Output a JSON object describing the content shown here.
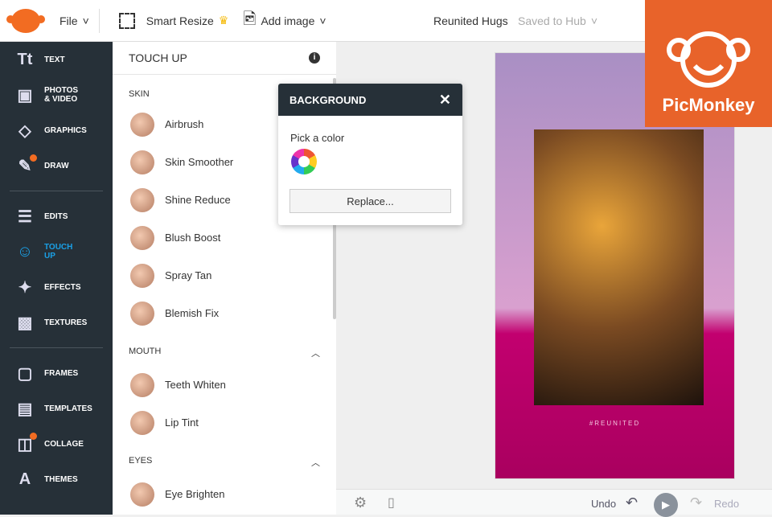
{
  "topbar": {
    "file": "File",
    "smart_resize": "Smart Resize",
    "add_image": "Add image",
    "doc_title": "Reunited Hugs",
    "save_status": "Saved to Hub"
  },
  "sidebar": [
    {
      "label": "TEXT",
      "icon": "Tt"
    },
    {
      "label": "PHOTOS & VIDEO",
      "icon": "▣"
    },
    {
      "label": "GRAPHICS",
      "icon": "◇"
    },
    {
      "label": "DRAW",
      "icon": "✎"
    },
    {
      "label": "EDITS",
      "icon": "☰"
    },
    {
      "label": "TOUCH UP",
      "icon": "☺"
    },
    {
      "label": "EFFECTS",
      "icon": "✦"
    },
    {
      "label": "TEXTURES",
      "icon": "▩"
    },
    {
      "label": "FRAMES",
      "icon": "▢"
    },
    {
      "label": "TEMPLATES",
      "icon": "▤"
    },
    {
      "label": "COLLAGE",
      "icon": "◫"
    },
    {
      "label": "THEMES",
      "icon": "A"
    }
  ],
  "panel": {
    "title": "TOUCH UP",
    "skin": "SKIN",
    "skin_items": [
      "Airbrush",
      "Skin Smoother",
      "Shine Reduce",
      "Blush Boost",
      "Spray Tan",
      "Blemish Fix"
    ],
    "mouth": "MOUTH",
    "mouth_items": [
      "Teeth Whiten",
      "Lip Tint"
    ],
    "eyes": "EYES",
    "eyes_items": [
      "Eye Brighten"
    ]
  },
  "popup": {
    "title": "BACKGROUND",
    "pick": "Pick a color",
    "replace": "Replace..."
  },
  "canvas": {
    "hashtag": "#REUNITED"
  },
  "bottom": {
    "undo": "Undo",
    "redo": "Redo"
  },
  "brand": {
    "name": "PicMonkey"
  },
  "colors": {
    "accent": "#f26c22",
    "sidebar": "#263038",
    "active": "#1aa0e6"
  }
}
